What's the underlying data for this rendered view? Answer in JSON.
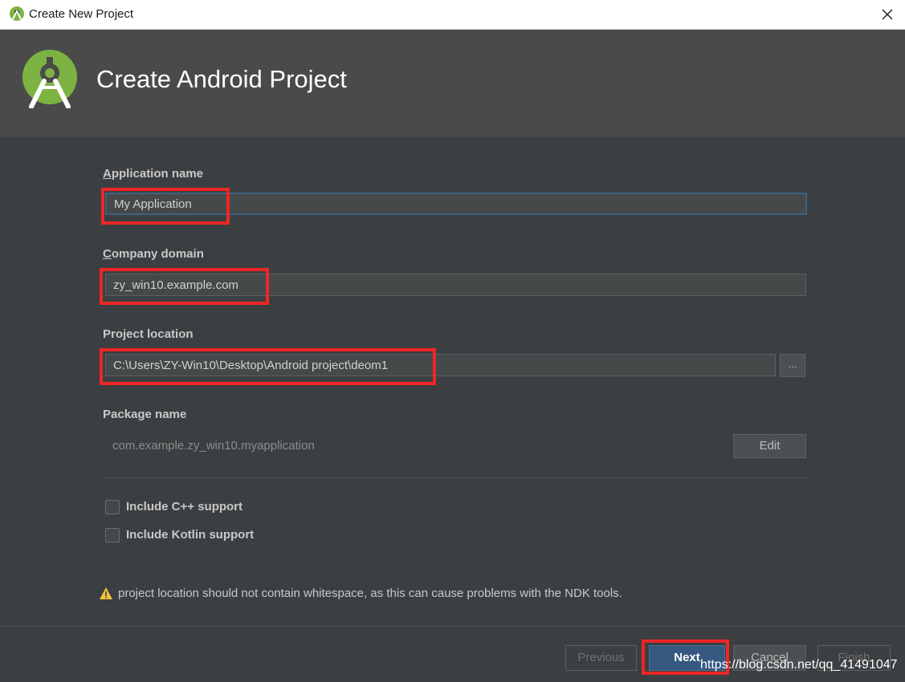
{
  "window": {
    "title": "Create New Project",
    "icon": "android-studio-icon",
    "close_icon": "close-icon"
  },
  "header": {
    "title": "Create Android Project",
    "logo": "android-studio-logo",
    "background": "#4a4a4a"
  },
  "form": {
    "app_name": {
      "label_first": "A",
      "label_rest": "pplication name",
      "value": "My Application"
    },
    "company_domain": {
      "label_first": "C",
      "label_rest": "ompany domain",
      "value": "zy_win10.example.com"
    },
    "project_location": {
      "label": "Project location",
      "value": "C:\\Users\\ZY-Win10\\Desktop\\Android project\\deom1",
      "browse_label": "..."
    },
    "package_name": {
      "label": "Package name",
      "value": "com.example.zy_win10.myapplication",
      "edit_label": "Edit"
    },
    "cpp_support": {
      "label": "Include C++ support",
      "checked": false
    },
    "kotlin_support": {
      "label": "Include Kotlin support",
      "checked": false
    },
    "warning": {
      "icon": "warning-icon",
      "text": "project location should not contain whitespace, as this can cause problems with the NDK tools."
    }
  },
  "footer": {
    "previous": "Previous",
    "next": "Next",
    "cancel": "Cancel",
    "finish": "Finish"
  },
  "watermark": "https://blog.csdn.net/qq_41491047",
  "colors": {
    "background": "#3c3f41",
    "accent": "#365880",
    "highlight": "#ee2626",
    "warning": "#f0c33c"
  }
}
